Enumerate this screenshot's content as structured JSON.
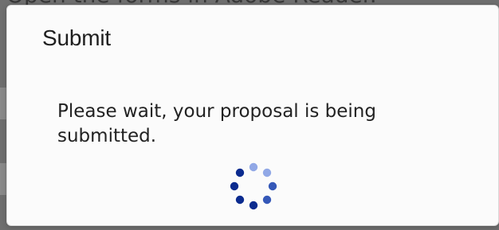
{
  "background": {
    "partial_text": "Open the forms in Adobe Reader."
  },
  "dialog": {
    "title": "Submit",
    "message": "Please wait, your proposal is being submitted.",
    "spinner_icon": "loading-spinner-icon"
  },
  "colors": {
    "backdrop": "#6f6f6f",
    "dialog_background": "#fbfbfb",
    "title_text": "#1f1f1f",
    "message_text": "#222222",
    "spinner_dark": "#0b2b8f",
    "spinner_mid": "#3558b8",
    "spinner_light": "#91a8e6"
  }
}
